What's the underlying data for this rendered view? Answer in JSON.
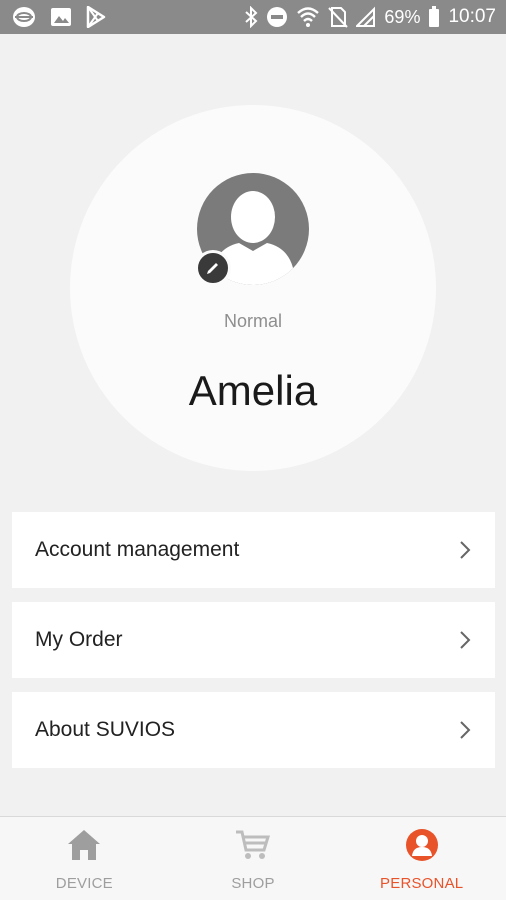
{
  "status_bar": {
    "battery": "69%",
    "time": "10:07",
    "icons": [
      "app-icon",
      "image-icon",
      "play-store-icon",
      "bluetooth-icon",
      "do-not-disturb-icon",
      "wifi-icon",
      "no-sim-icon",
      "signal-icon",
      "battery-icon"
    ]
  },
  "profile": {
    "level": "Normal",
    "name": "Amelia"
  },
  "menu": {
    "items": [
      {
        "label": "Account management"
      },
      {
        "label": "My Order"
      },
      {
        "label": "About SUVIOS"
      }
    ]
  },
  "bottom_nav": {
    "items": [
      {
        "label": "DEVICE",
        "icon": "home-icon"
      },
      {
        "label": "SHOP",
        "icon": "cart-icon"
      },
      {
        "label": "PERSONAL",
        "icon": "person-icon",
        "active": true
      }
    ],
    "active_color": "#e8532a",
    "inactive_color": "#9e9e9e"
  }
}
